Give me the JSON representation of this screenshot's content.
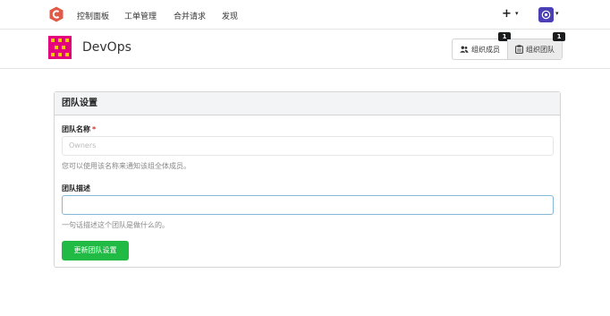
{
  "nav": {
    "items": [
      {
        "label": "控制面板"
      },
      {
        "label": "工单管理"
      },
      {
        "label": "合并请求"
      },
      {
        "label": "发现"
      }
    ],
    "plus": "+",
    "caret": "▾"
  },
  "org": {
    "name": "DevOps",
    "tabs": [
      {
        "label": "组织成员",
        "count": "1",
        "icon": "people-icon"
      },
      {
        "label": "组织团队",
        "count": "1",
        "icon": "team-icon"
      }
    ]
  },
  "settings": {
    "heading": "团队设置",
    "name_label": "团队名称",
    "required_mark": "*",
    "name_value": "Owners",
    "name_help": "您可以使用该名称来通知该组全体成员。",
    "desc_label": "团队描述",
    "desc_value": "",
    "desc_help": "一句话描述这个团队是做什么的。",
    "submit_label": "更新团队设置"
  },
  "colors": {
    "brand": "#e05a47",
    "accent": "#21ba45",
    "badge": "#1b1c1d",
    "org_avatar_bg": "#e4007f",
    "org_avatar_fg": "#f5c500"
  }
}
